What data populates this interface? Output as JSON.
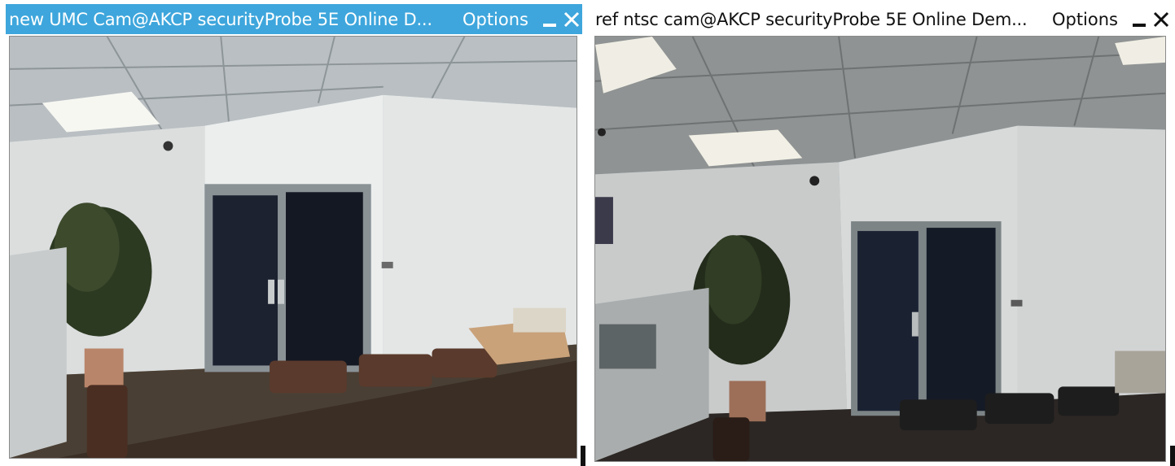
{
  "windows": [
    {
      "title": "new UMC Cam@AKCP securityProbe 5E Online D...",
      "options_label": "Options",
      "minimize_icon": "minimize-icon",
      "close_icon": "close-icon",
      "active": true,
      "titlebar_color": "#3ea6dc"
    },
    {
      "title": "ref ntsc cam@AKCP securityProbe 5E Online Dem...",
      "options_label": "Options",
      "minimize_icon": "minimize-icon",
      "close_icon": "close-icon",
      "active": false,
      "titlebar_color": "#ffffff"
    }
  ]
}
